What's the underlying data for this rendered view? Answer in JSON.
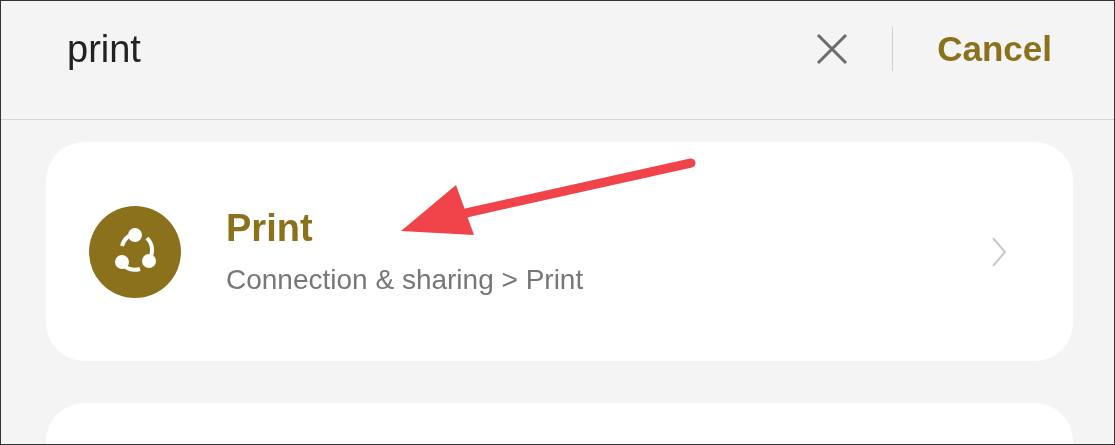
{
  "search": {
    "value": "print",
    "cancel": "Cancel"
  },
  "results": [
    {
      "title": "Print",
      "path": "Connection & sharing > Print"
    }
  ]
}
